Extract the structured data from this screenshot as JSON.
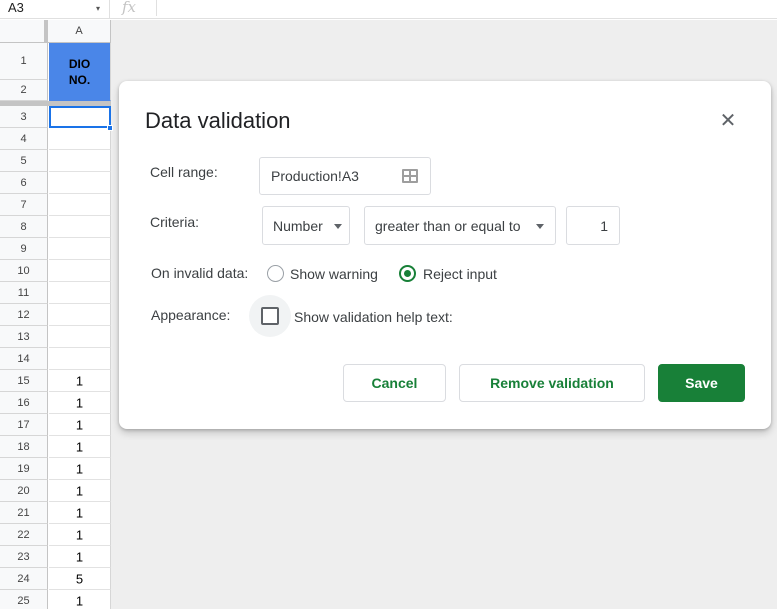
{
  "formula_bar": {
    "name_box": "A3",
    "name_box_arrow": "▾",
    "fx_label": "fx"
  },
  "sheet": {
    "column_header": "A",
    "header_cell": "DIO\nNO.",
    "rows": [
      {
        "n": "1",
        "v": ""
      },
      {
        "n": "2",
        "v": ""
      },
      {
        "n": "3",
        "v": ""
      },
      {
        "n": "4",
        "v": ""
      },
      {
        "n": "5",
        "v": ""
      },
      {
        "n": "6",
        "v": ""
      },
      {
        "n": "7",
        "v": ""
      },
      {
        "n": "8",
        "v": ""
      },
      {
        "n": "9",
        "v": ""
      },
      {
        "n": "10",
        "v": ""
      },
      {
        "n": "11",
        "v": ""
      },
      {
        "n": "12",
        "v": ""
      },
      {
        "n": "13",
        "v": ""
      },
      {
        "n": "14",
        "v": ""
      },
      {
        "n": "15",
        "v": "1"
      },
      {
        "n": "16",
        "v": "1"
      },
      {
        "n": "17",
        "v": "1"
      },
      {
        "n": "18",
        "v": "1"
      },
      {
        "n": "19",
        "v": "1"
      },
      {
        "n": "20",
        "v": "1"
      },
      {
        "n": "21",
        "v": "1"
      },
      {
        "n": "22",
        "v": "1"
      },
      {
        "n": "23",
        "v": "1"
      },
      {
        "n": "24",
        "v": "5"
      },
      {
        "n": "25",
        "v": "1"
      }
    ]
  },
  "dialog": {
    "title": "Data validation",
    "close_glyph": "✕",
    "cell_range": {
      "label": "Cell range:",
      "value": "Production!A3"
    },
    "criteria": {
      "label": "Criteria:",
      "type": "Number",
      "operator": "greater than or equal to",
      "value": "1"
    },
    "invalid_data": {
      "label": "On invalid data:",
      "options": [
        "Show warning",
        "Reject input"
      ],
      "selected": "Reject input"
    },
    "appearance": {
      "label": "Appearance:",
      "checkbox_label": "Show validation help text:",
      "checked": false
    },
    "buttons": {
      "cancel": "Cancel",
      "remove": "Remove validation",
      "save": "Save"
    }
  },
  "colors": {
    "header_fill": "#4a86e8",
    "accent_green": "#188038",
    "selection_blue": "#1a73e8"
  }
}
